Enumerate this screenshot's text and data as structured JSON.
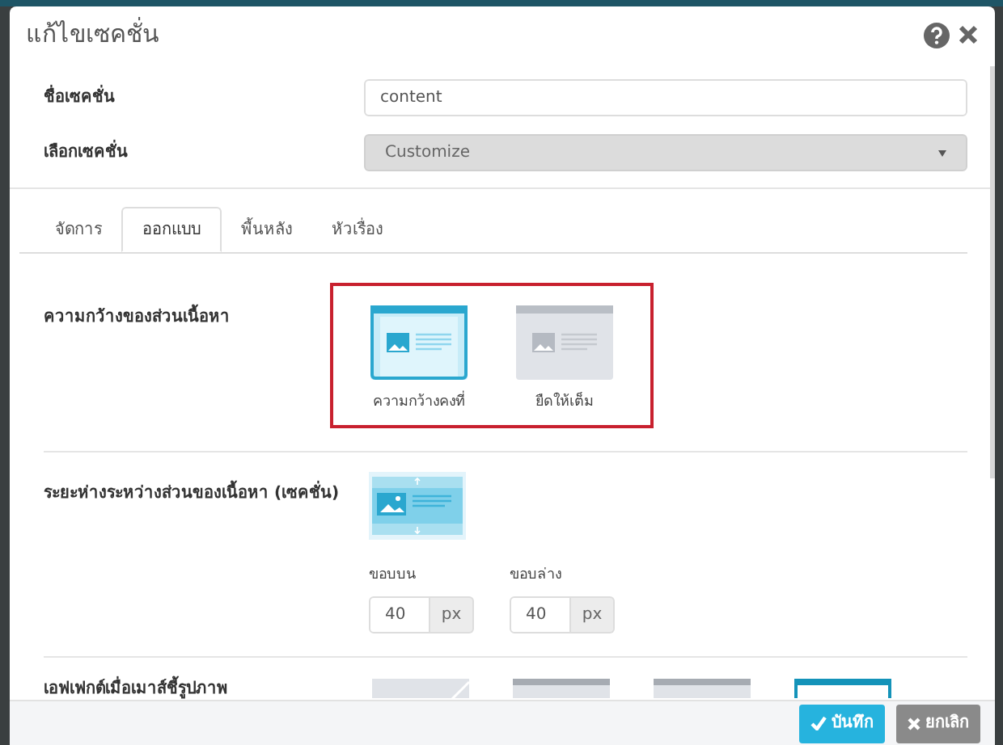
{
  "dialog": {
    "title": "แก้ไขเซคชั่น"
  },
  "fields": [
    {
      "label": "ชื่อเซคชั่น",
      "kind": "text",
      "value": "content"
    },
    {
      "label": "เลือกเซคชั่น",
      "kind": "select",
      "value": "Customize"
    }
  ],
  "tabs": [
    {
      "label": "จัดการ",
      "selected": false
    },
    {
      "label": "ออกแบบ",
      "selected": true
    },
    {
      "label": "พื้นหลัง",
      "selected": false
    },
    {
      "label": "หัวเรื่อง",
      "selected": false
    }
  ],
  "content_width": {
    "label": "ความกว้างของส่วนเนื้อหา",
    "options": [
      {
        "label": "ความกว้างคงที่",
        "kind": "fixed",
        "selected": true
      },
      {
        "label": "ยืดให้เต็ม",
        "kind": "full",
        "selected": false
      }
    ]
  },
  "spacing": {
    "label": "ระยะห่างระหว่างส่วนของเนื้อหา (เซคชั่น)",
    "inputs": [
      {
        "label": "ขอบบน",
        "value": "40",
        "unit": "px"
      },
      {
        "label": "ขอบล่าง",
        "value": "40",
        "unit": "px"
      }
    ]
  },
  "hover_effect": {
    "label": "เอฟเฟกต์เมื่อเมาส์ชี้รูปภาพ",
    "options": [
      {
        "kind": "diagonal",
        "selected": false
      },
      {
        "kind": "bar",
        "selected": false
      },
      {
        "kind": "bar",
        "selected": false
      },
      {
        "kind": "bar",
        "selected": true
      }
    ]
  },
  "buttons": [
    {
      "label": "บันทึก",
      "kind": "save"
    },
    {
      "label": "ยกเลิก",
      "kind": "cancel"
    }
  ]
}
